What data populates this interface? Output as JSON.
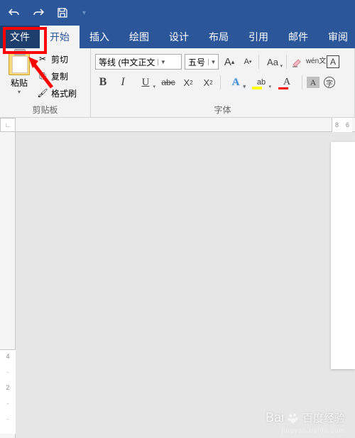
{
  "qat": {
    "undo": "↶",
    "redo": "↷",
    "save": "💾",
    "more": "▾"
  },
  "tabs": {
    "file": "文件",
    "home": "开始",
    "insert": "插入",
    "draw": "绘图",
    "design": "设计",
    "layout": "布局",
    "references": "引用",
    "mailings": "邮件",
    "review": "审阅"
  },
  "clipboard": {
    "paste": "粘贴",
    "cut": "剪切",
    "copy": "复制",
    "format_painter": "格式刷",
    "group_label": "剪贴板"
  },
  "font": {
    "family": "等线 (中文正文",
    "size": "五号",
    "grow": "A",
    "grow_sup": "▴",
    "shrink": "A",
    "shrink_sup": "▾",
    "change_case": "Aa",
    "ruby_top": "wén",
    "ruby_bot": "文",
    "char_border": "A",
    "bold": "B",
    "italic": "I",
    "underline": "U",
    "strike": "abc",
    "sub": "X",
    "sub_s": "2",
    "sup": "X",
    "sup_s": "2",
    "effect": "A",
    "highlight": "ab",
    "color": "A",
    "shade": "A",
    "enclose": "字",
    "group_label": "字体"
  },
  "ruler": {
    "corner": "∟",
    "h1": "8",
    "h2": "6",
    "v1": "4",
    "v2": "2"
  },
  "watermark": {
    "text": "百度经验",
    "sub": "jingyan.baidu.com"
  }
}
